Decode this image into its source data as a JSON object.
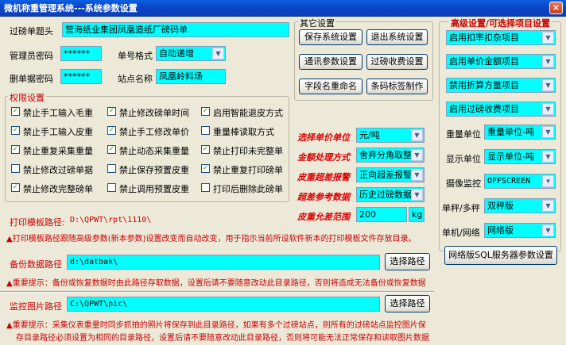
{
  "window": {
    "title": "微机称重管理系统---系统参数设置",
    "close": "×"
  },
  "basic": {
    "receipt_title_label": "过磅单题头",
    "receipt_title": "营海纸业集团凤凰造纸厂磅码单",
    "admin_pwd_label": "管理员密码",
    "admin_pwd": "******",
    "delete_pwd_label": "删单据密码",
    "delete_pwd": "******",
    "number_format_label": "单号格式",
    "number_format": "自动递增",
    "station_label": "站点名称",
    "station": "凤凰岭料场"
  },
  "perm": {
    "title": "权限设置",
    "items": [
      {
        "label": "禁止手工输入毛重",
        "checked": true
      },
      {
        "label": "禁止修改磅单时间",
        "checked": true
      },
      {
        "label": "启用智能退皮方式",
        "checked": true
      },
      {
        "label": "禁止手工输入皮重",
        "checked": true
      },
      {
        "label": "禁止手工修改单价",
        "checked": true
      },
      {
        "label": "重量棒读取方式",
        "checked": false
      },
      {
        "label": "禁止重复采集重量",
        "checked": true
      },
      {
        "label": "禁止动态采集重量",
        "checked": true
      },
      {
        "label": "禁止打印未完整单",
        "checked": true
      },
      {
        "label": "禁止修改过磅单据",
        "checked": false
      },
      {
        "label": "禁止保存预置皮重",
        "checked": false
      },
      {
        "label": "禁止重复打印磅单",
        "checked": true
      },
      {
        "label": "禁止修改完整磅单",
        "checked": true
      },
      {
        "label": "禁止调用预置皮重",
        "checked": false
      },
      {
        "label": "打印后删除此磅单",
        "checked": false
      }
    ]
  },
  "other": {
    "title": "其它设置",
    "buttons": [
      "保存系统设置",
      "退出系统设置",
      "通讯参数设置",
      "过磅收费设置",
      "字段名重命名",
      "条码标签制作"
    ]
  },
  "pricing": {
    "unit_label": "选择单价单位",
    "unit": "元/吨",
    "amount_label": "金额处理方式",
    "amount": "舍弃分角取整",
    "overdiff_label": "皮重超差报警",
    "overdiff": "正向超差报警",
    "ref_label": "超差参考数据",
    "ref": "历史过磅数据",
    "allow_label": "皮重允差范围",
    "allow": "200",
    "allow_unit": "kg"
  },
  "print": {
    "path_label": "打印模板路径:",
    "path": "D:\\QPWT\\rpt\\1110\\",
    "note": "▲打印模板路径跟随高级参数(新本参数)设置改变而自动改变，用于指示当前所设软件新本的打印模板文件存放目录。"
  },
  "backup": {
    "label": "备份数据路径",
    "path": "d:\\datbak\\",
    "button": "选择路径",
    "note": "▲重要提示：备份或恢复数据时由此路径存取数据，设置后请不要随意改动此目录路径，否则将造成无法备份或恢复数据"
  },
  "monitor": {
    "label": "监控图片路径",
    "path": "C:\\QPWT\\pic\\",
    "button": "选择路径",
    "note1": "▲重要提示：采集仪表重量时同步抓拍的照片将保存到此目录路径，如果有多个过磅站点，则所有的过磅站点监控图片保",
    "note2": "存目录路径必须设置为相同的目录路径，设置后请不要随意改动此目录路径，否则将可能无法正常保存和读取图片数据"
  },
  "advanced": {
    "title": "高级设置/可选择项目设置",
    "options": [
      "启用扣率扣杂项目",
      "启用单价金额项目",
      "禁用折算方量项目",
      "启用过磅收费项目"
    ],
    "weight_unit_label": "重量单位",
    "weight_unit": "重量单位-吨",
    "display_unit_label": "显示单位",
    "display_unit": "显示单位-吨",
    "camera_label": "摄像监控",
    "camera": "OFFSCREEN",
    "mode_label": "单秤/多秤",
    "mode": "双秤版",
    "net_label": "单机/网络",
    "net": "网络版",
    "sql_button": "网络版SQL服务器参数设置"
  }
}
